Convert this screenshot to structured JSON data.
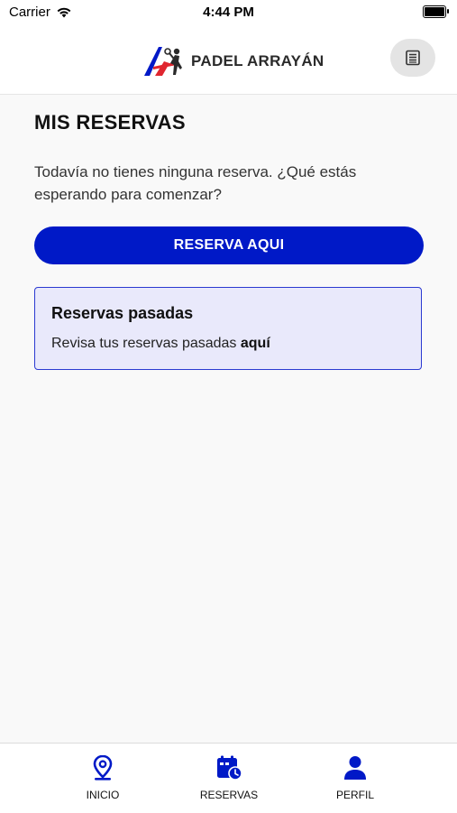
{
  "status_bar": {
    "carrier": "Carrier",
    "time": "4:44 PM"
  },
  "header": {
    "brand": "PADEL ARRAYÁN",
    "menu_icon": "list-icon"
  },
  "main": {
    "title": "MIS RESERVAS",
    "empty_message": "Todavía no tienes ninguna reserva. ¿Qué estás esperando para comenzar?",
    "reserve_button": "RESERVA AQUI",
    "past": {
      "title": "Reservas pasadas",
      "text": "Revisa tus reservas pasadas ",
      "link": "aquí"
    }
  },
  "tabs": [
    {
      "label": "INICIO",
      "icon": "location-pin-icon"
    },
    {
      "label": "RESERVAS",
      "icon": "calendar-clock-icon"
    },
    {
      "label": "PERFIL",
      "icon": "user-icon"
    }
  ],
  "colors": {
    "primary": "#0019c7",
    "card_bg": "#e9e9fb",
    "card_border": "#2b3ad1",
    "logo_red": "#e0262f"
  }
}
